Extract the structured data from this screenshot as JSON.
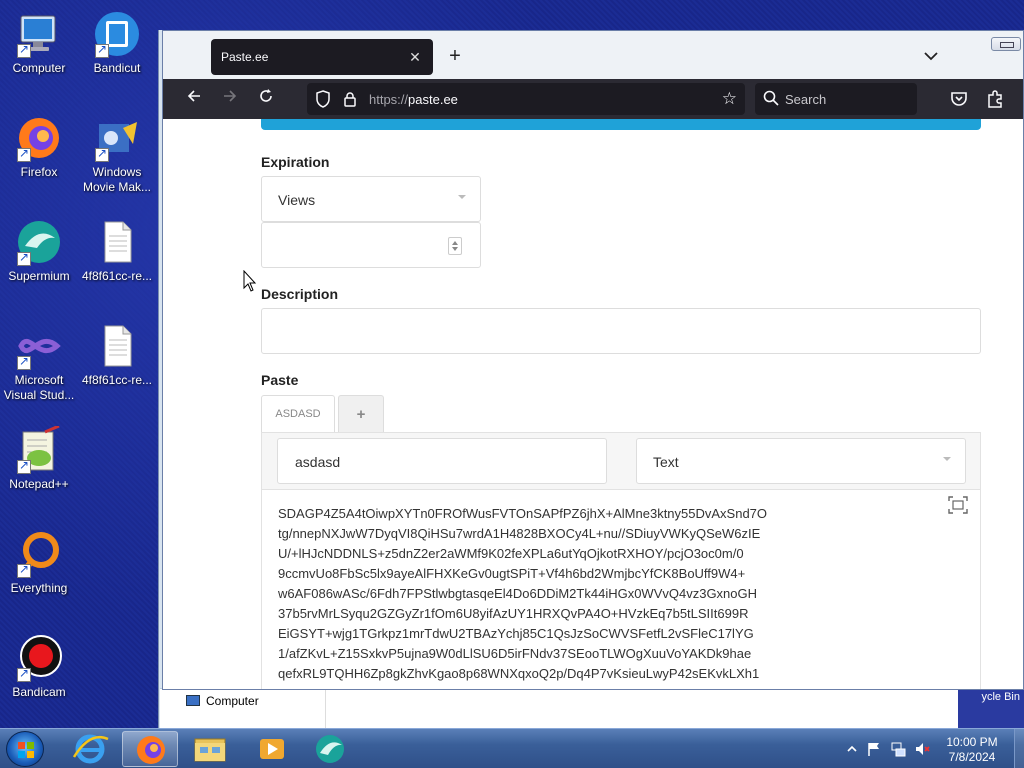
{
  "desktop": {
    "icons": [
      {
        "label": "Computer"
      },
      {
        "label": "Bandicut"
      },
      {
        "label": "Firefox"
      },
      {
        "label": "Windows Movie Mak..."
      },
      {
        "label": "Supermium"
      },
      {
        "label": "4f8f61cc-re..."
      },
      {
        "label": "Microsoft Visual Stud..."
      },
      {
        "label": "4f8f61cc-re..."
      },
      {
        "label": "Notepad++"
      },
      {
        "label": "Everything"
      },
      {
        "label": "Bandicam"
      }
    ]
  },
  "explorer": {
    "nav_item": "Computer",
    "right_fragment": "ycle Bin"
  },
  "browser": {
    "tab_title": "Paste.ee",
    "url_protocol": "https://",
    "url_host": "paste.ee",
    "search_placeholder": "Search"
  },
  "form": {
    "expiration_label": "Expiration",
    "expiration_value": "Views",
    "description_label": "Description",
    "paste_label": "Paste",
    "paste_tab": "ASDASD",
    "add_tab": "+",
    "paste_name": "asdasd",
    "syntax_value": "Text",
    "paste_lines": [
      "SDAGP4Z5A4tOiwpXYTn0FROfWusFVTOnSAPfPZ6jhX+AlMne3ktny55DvAxSnd7O",
      "tg/nnepNXJwW7DyqVI8QiHSu7wrdA1H4828BXOCy4L+nu//SDiuyVWKyQSeW6zIE",
      "U/+lHJcNDDNLS+z5dnZ2er2aWMf9K02feXPLa6utYqOjkotRXHOY/pcjO3oc0m/0",
      "9ccmvUo8FbSc5lx9ayeAlFHXKeGv0ugtSPiT+Vf4h6bd2WmjbcYfCK8BoUff9W4+",
      "w6AF086wASc/6Fdh7FPStlwbgtasqeEl4Do6DDiM2Tk44iHGx0WVvQ4vz3GxnoGH",
      "37b5rvMrLSyqu2GZGyZr1fOm6U8yifAzUY1HRXQvPA4O+HVzkEq7b5tLSIIt699R",
      "EiGSYT+wjg1TGrkpz1mrTdwU2TBAzYchj85C1QsJzSoCWVSFetfL2vSFleC17lYG",
      "1/afZKvL+Z15SxkvP5ujna9W0dLlSU6D5irFNdv37SEooTLWOgXuuVoYAKDk9hae",
      "qefxRL9TQHH6Zp8gkZhvKgao8p68WNXqxoQ2p/Dq4P7vKsieuLwyP42sEKvkLXh1"
    ]
  },
  "taskbar": {
    "time": "10:00 PM",
    "date": "7/8/2024"
  }
}
